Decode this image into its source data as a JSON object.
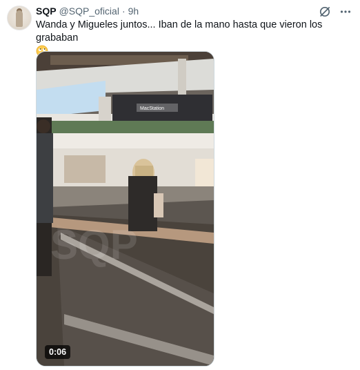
{
  "tweet": {
    "author_name": "SQP",
    "handle": "@SQP_oficial",
    "separator": "·",
    "time": "9h",
    "text": "Wanda y Migueles juntos... Iban de la mano hasta que vieron los grababan",
    "emoji": "face-with-rolling-eyes-emoji",
    "avatar": "profile-avatar",
    "actions": {
      "grok_icon": "grok-slash-circle-icon",
      "more_icon": "more-dots-icon"
    }
  },
  "media": {
    "type": "video",
    "duration": "0:06",
    "store_sign": "MacStation",
    "watermark": "SQP"
  }
}
